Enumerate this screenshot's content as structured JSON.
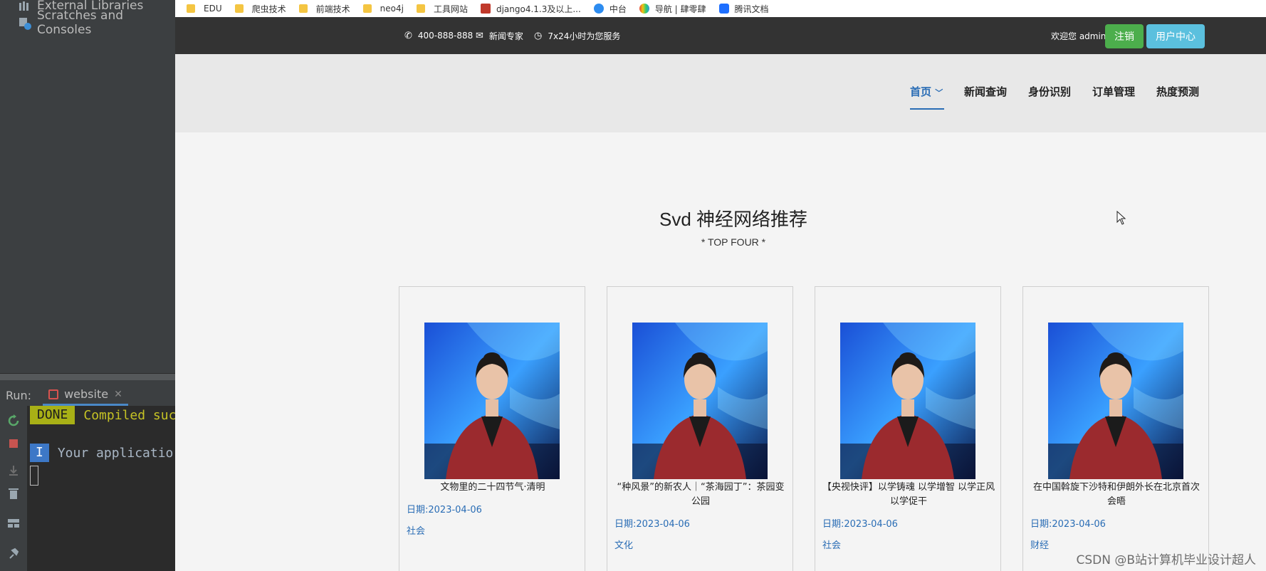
{
  "ide": {
    "tree_items": [
      "External Libraries",
      "Scratches and Consoles"
    ],
    "run_label": "Run:",
    "run_tab": "website",
    "console": {
      "done_badge": "DONE",
      "compiled_text": "Compiled suc",
      "info_badge": "I",
      "app_text": "Your applicatio"
    }
  },
  "bookmarks": [
    {
      "label": "EDU",
      "icon": "folder-icon"
    },
    {
      "label": "爬虫技术",
      "icon": "folder-icon"
    },
    {
      "label": "前端技术",
      "icon": "folder-icon"
    },
    {
      "label": "neo4j",
      "icon": "folder-icon"
    },
    {
      "label": "工具网站",
      "icon": "folder-icon"
    },
    {
      "label": "django4.1.3及以上...",
      "icon": "site-icon"
    },
    {
      "label": "中台",
      "icon": "site-icon"
    },
    {
      "label": "导航 | 肆零肆",
      "icon": "site-icon"
    },
    {
      "label": "腾讯文档",
      "icon": "site-icon"
    }
  ],
  "topbar": {
    "phone": "400-888-888",
    "email": "新闻专家",
    "hours": "7x24小时为您服务",
    "welcome": "欢迎您 admin",
    "logout": "注销",
    "user_center": "用户中心"
  },
  "nav": {
    "items": [
      "首页",
      "新闻查询",
      "身份识别",
      "订单管理",
      "热度预测"
    ],
    "active_index": 0
  },
  "section": {
    "title": "Svd 神经网络推荐",
    "subtitle": "* TOP FOUR *"
  },
  "cards": [
    {
      "title": "文物里的二十四节气·清明",
      "date": "日期:2023-04-06",
      "category": "社会"
    },
    {
      "title": "“种风景”的新农人｜“茶海园丁”：茶园变公园",
      "date": "日期:2023-04-06",
      "category": "文化"
    },
    {
      "title": "【央视快评】以学铸魂 以学增智 以学正风 以学促干",
      "date": "日期:2023-04-06",
      "category": "社会"
    },
    {
      "title": "在中国斡旋下沙特和伊朗外长在北京首次会晤",
      "date": "日期:2023-04-06",
      "category": "财经"
    }
  ],
  "watermark": "CSDN @B站计算机毕业设计超人",
  "colors": {
    "topbar_bg": "#333333",
    "nav_active": "#2a6db5",
    "logout_btn": "#4cae4c",
    "user_btn": "#5bc0de"
  }
}
